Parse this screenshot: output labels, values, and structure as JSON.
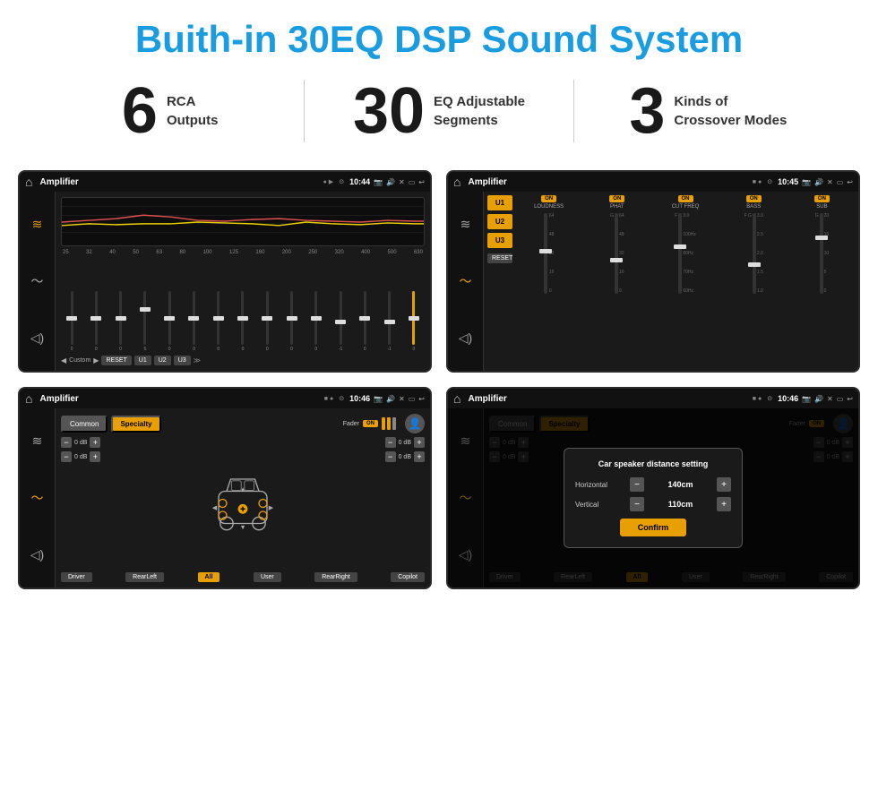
{
  "header": {
    "title": "Buith-in 30EQ DSP Sound System"
  },
  "stats": [
    {
      "number": "6",
      "text_line1": "RCA",
      "text_line2": "Outputs"
    },
    {
      "number": "30",
      "text_line1": "EQ Adjustable",
      "text_line2": "Segments"
    },
    {
      "number": "3",
      "text_line1": "Kinds of",
      "text_line2": "Crossover Modes"
    }
  ],
  "screens": [
    {
      "id": "screen1",
      "status_title": "Amplifier",
      "status_dots": "● ▶",
      "time": "10:44",
      "type": "eq"
    },
    {
      "id": "screen2",
      "status_title": "Amplifier",
      "status_dots": "■ ●",
      "time": "10:45",
      "type": "amp"
    },
    {
      "id": "screen3",
      "status_title": "Amplifier",
      "status_dots": "■ ●",
      "time": "10:46",
      "type": "common"
    },
    {
      "id": "screen4",
      "status_title": "Amplifier",
      "status_dots": "■ ●",
      "time": "10:46",
      "type": "dialog"
    }
  ],
  "eq": {
    "labels": [
      "25",
      "32",
      "40",
      "50",
      "63",
      "80",
      "100",
      "125",
      "160",
      "200",
      "250",
      "320",
      "400",
      "500",
      "630"
    ],
    "values": [
      "0",
      "0",
      "0",
      "5",
      "0",
      "0",
      "0",
      "0",
      "0",
      "0",
      "0",
      "-1",
      "0",
      "-1"
    ],
    "bottom_label": "Custom",
    "buttons": [
      "RESET",
      "U1",
      "U2",
      "U3"
    ]
  },
  "amp": {
    "u_buttons": [
      "U1",
      "U2",
      "U3"
    ],
    "controls": [
      "LOUDNESS",
      "PHAT",
      "CUT FREQ",
      "BASS",
      "SUB"
    ],
    "reset": "RESET"
  },
  "common": {
    "tabs": [
      "Common",
      "Specialty"
    ],
    "fader": "Fader",
    "fader_on": "ON",
    "buttons": [
      "Driver",
      "RearLeft",
      "All",
      "User",
      "RearRight",
      "Copilot"
    ],
    "db_values": [
      "0 dB",
      "0 dB",
      "0 dB",
      "0 dB"
    ]
  },
  "dialog": {
    "title": "Car speaker distance setting",
    "horizontal_label": "Horizontal",
    "horizontal_value": "140cm",
    "vertical_label": "Vertical",
    "vertical_value": "110cm",
    "confirm_label": "Confirm"
  }
}
